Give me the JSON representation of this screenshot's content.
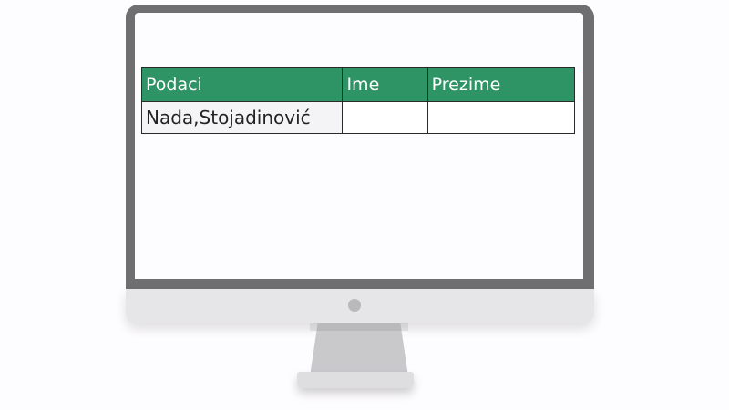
{
  "table": {
    "headers": [
      "Podaci",
      "Ime",
      "Prezime"
    ],
    "rows": [
      [
        "Nada,Stojadinović",
        "",
        ""
      ]
    ]
  },
  "colors": {
    "header_background": "#2f9465",
    "header_text": "#ffffff",
    "bezel": "#6f6f72",
    "chin": "#e6e6e8"
  }
}
